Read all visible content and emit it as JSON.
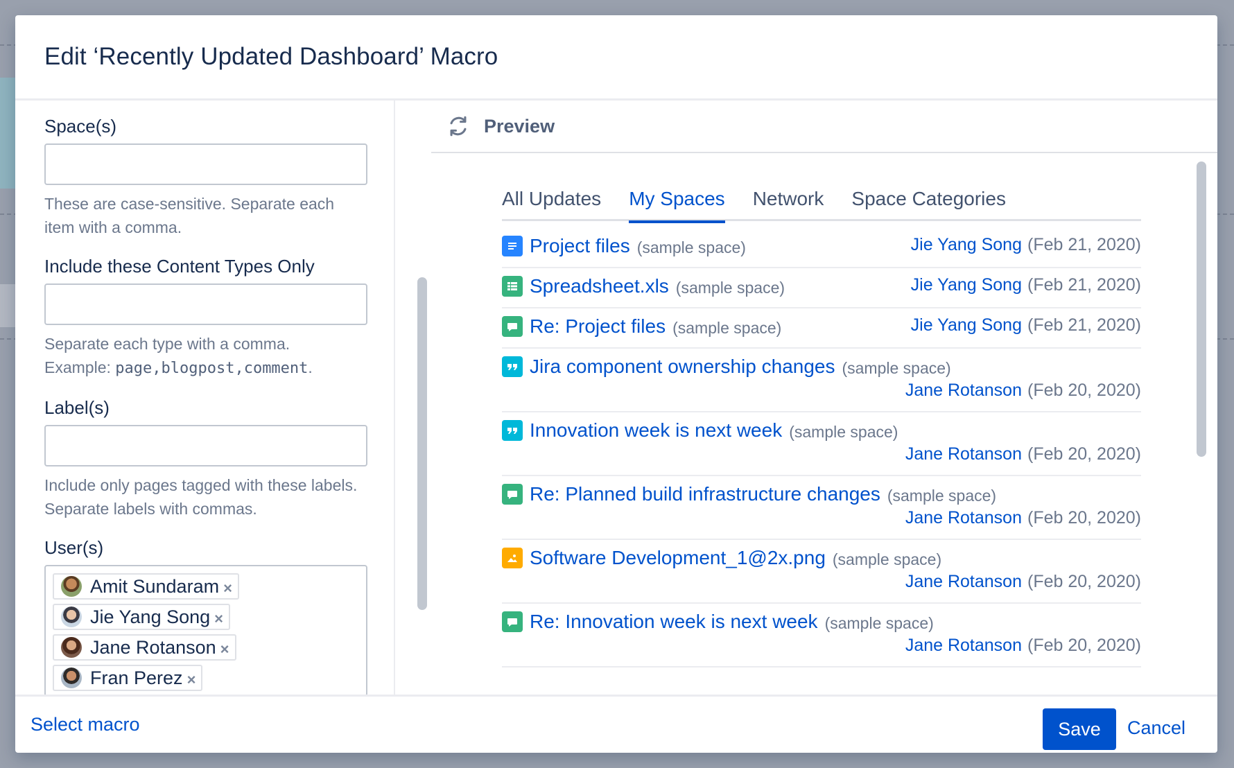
{
  "dialog": {
    "title": "Edit ‘Recently Updated Dashboard’ Macro"
  },
  "form": {
    "spaces": {
      "label": "Space(s)",
      "value": "",
      "help": "These are case-sensitive. Separate each item with a comma."
    },
    "content_types": {
      "label": "Include these Content Types Only",
      "value": "",
      "help_line1": "Separate each type with a comma.",
      "help_example_prefix": "Example: ",
      "help_example_code": "page,blogpost,comment",
      "help_example_suffix": "."
    },
    "labels": {
      "label": "Label(s)",
      "value": "",
      "help": "Include only pages tagged with these labels. Separate labels with commas."
    },
    "users": {
      "label": "User(s)",
      "selected": [
        {
          "name": "Amit Sundaram",
          "remove": "×"
        },
        {
          "name": "Jie Yang Song",
          "remove": "×"
        },
        {
          "name": "Jane Rotanson",
          "remove": "×"
        },
        {
          "name": "Fran Perez",
          "remove": "×"
        }
      ]
    }
  },
  "preview": {
    "label": "Preview",
    "tabs": [
      {
        "label": "All Updates",
        "active": false
      },
      {
        "label": "My Spaces",
        "active": true
      },
      {
        "label": "Network",
        "active": false
      },
      {
        "label": "Space Categories",
        "active": false
      }
    ],
    "updates": [
      {
        "icon": "page-icon",
        "title": "Project files",
        "space": "(sample space)",
        "user": "Jie Yang Song",
        "date": "(Feb 21, 2020)"
      },
      {
        "icon": "spreadsheet-icon",
        "title": "Spreadsheet.xls",
        "space": "(sample space)",
        "user": "Jie Yang Song",
        "date": "(Feb 21, 2020)"
      },
      {
        "icon": "comment-icon",
        "title": "Re: Project files",
        "space": "(sample space)",
        "user": "Jie Yang Song",
        "date": "(Feb 21, 2020)"
      },
      {
        "icon": "blogpost-icon",
        "title": "Jira component ownership changes",
        "space": "(sample space)",
        "user": "Jane Rotanson",
        "date": "(Feb 20, 2020)"
      },
      {
        "icon": "blogpost-icon",
        "title": "Innovation week is next week",
        "space": "(sample space)",
        "user": "Jane Rotanson",
        "date": "(Feb 20, 2020)"
      },
      {
        "icon": "comment-icon",
        "title": "Re: Planned build infrastructure changes",
        "space": "(sample space)",
        "user": "Jane Rotanson",
        "date": "(Feb 20, 2020)"
      },
      {
        "icon": "image-icon",
        "title": "Software Development_1@2x.png",
        "space": "(sample space)",
        "user": "Jane Rotanson",
        "date": "(Feb 20, 2020)"
      },
      {
        "icon": "comment-icon",
        "title": "Re: Innovation week is next week",
        "space": "(sample space)",
        "user": "Jane Rotanson",
        "date": "(Feb 20, 2020)"
      }
    ]
  },
  "footer": {
    "select_macro": "Select macro",
    "save": "Save",
    "cancel": "Cancel"
  },
  "colors": {
    "primary": "#0052cc",
    "page_icon": "#2684ff",
    "spreadsheet_icon": "#36b37e",
    "comment_icon": "#36b37e",
    "blogpost_icon": "#00b8d9",
    "image_icon": "#ffab00"
  }
}
